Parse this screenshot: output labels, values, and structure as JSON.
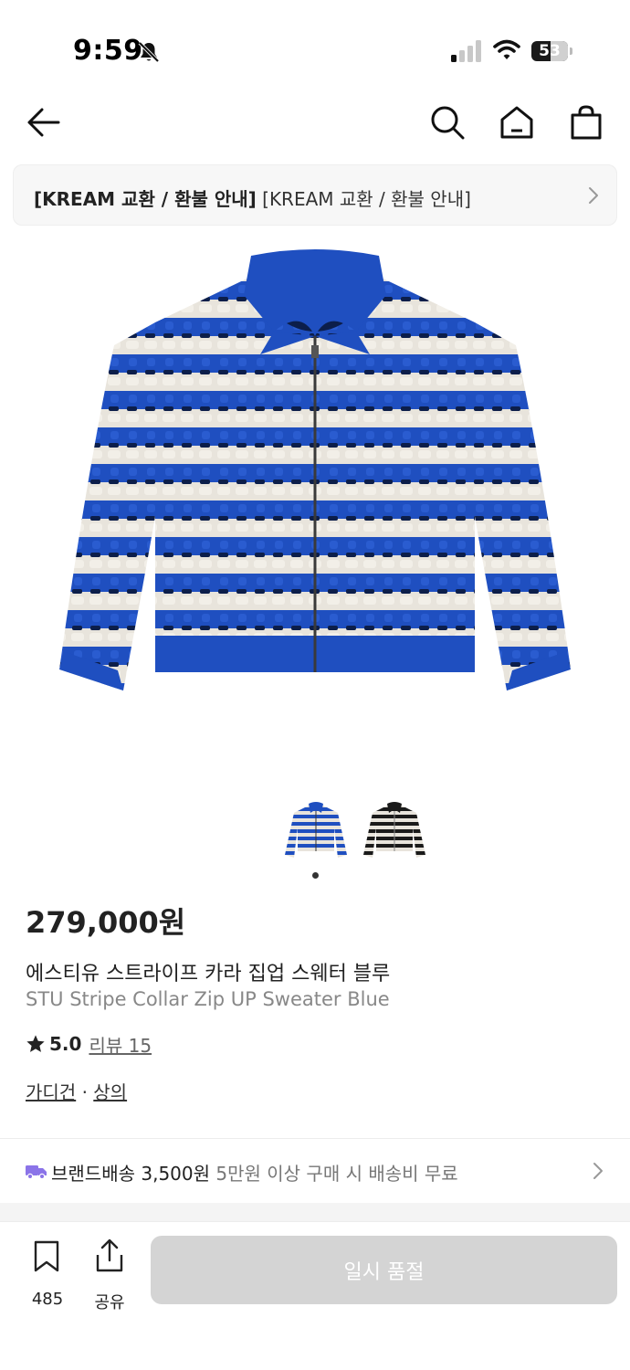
{
  "status_bar": {
    "time": "9:59",
    "battery": "53",
    "battery_level_percent": 53,
    "icons": [
      "bell-slash-icon",
      "cellular-signal-icon",
      "wifi-icon",
      "battery-icon"
    ]
  },
  "nav": {
    "icons": [
      "back-arrow-icon",
      "search-icon",
      "home-icon",
      "shopping-bag-icon"
    ]
  },
  "notice": {
    "bold": "[KREAM 교환 / 환불 안내]",
    "text": "[KREAM 교환 / 환불 안내]"
  },
  "product": {
    "image_colors": {
      "blue": "#1f4fc0",
      "cream": "#e8e4dc",
      "navy": "#0c1e4a"
    },
    "thumbnails": [
      "blue-cardigan-thumb",
      "black-cardigan-thumb"
    ],
    "active_thumbnail_index": 0,
    "price": "279,000원",
    "name_ko": "에스티유 스트라이프 카라 집업 스웨터 블루",
    "name_en": "STU Stripe Collar Zip UP Sweater Blue",
    "rating": "5.0",
    "review_label": "리뷰 15",
    "categories": [
      "가디건",
      "상의"
    ],
    "category_separator": "·"
  },
  "shipping": {
    "label": "브랜드배송 3,500원",
    "note": "5만원 이상 구매 시 배송비 무료",
    "icon_color": "#8b74e8"
  },
  "bottom_bar": {
    "bookmark_count": "485",
    "share_label": "공유",
    "cta_label": "일시 품절"
  }
}
